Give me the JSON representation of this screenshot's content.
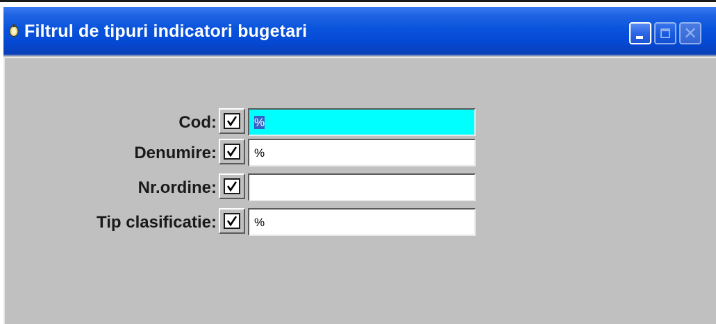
{
  "window": {
    "title": "Filtrul de tipuri indicatori bugetari",
    "icon": "app-icon",
    "buttons": [
      "minimize-button",
      "maximize-button",
      "close-button"
    ],
    "close_glyph": "✕"
  },
  "form": {
    "rows": [
      {
        "label": "Cod:",
        "checked": true,
        "value": "%",
        "focused": true
      },
      {
        "label": "Denumire:",
        "checked": true,
        "value": "%",
        "focused": false
      },
      {
        "label": "Nr.ordine:",
        "checked": true,
        "value": "",
        "focused": false
      },
      {
        "label": "Tip clasificatie:",
        "checked": true,
        "value": "%",
        "focused": false
      }
    ]
  },
  "colors": {
    "titlebar": "#0a54dc",
    "client_bg": "#c0c0c0",
    "focus_field_bg": "#00ffff",
    "selection_bg": "#3264c8"
  }
}
